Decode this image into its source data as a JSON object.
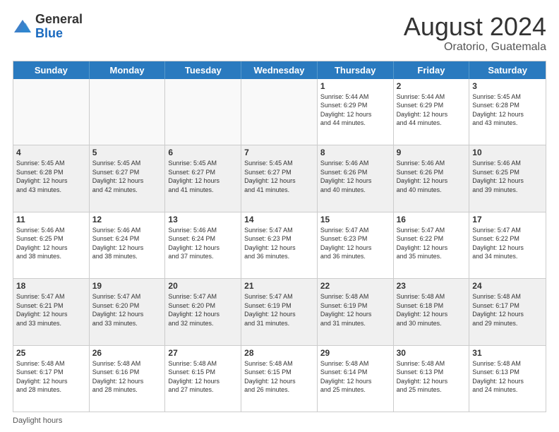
{
  "header": {
    "logo_general": "General",
    "logo_blue": "Blue",
    "month_title": "August 2024",
    "location": "Oratorio, Guatemala"
  },
  "weekdays": [
    "Sunday",
    "Monday",
    "Tuesday",
    "Wednesday",
    "Thursday",
    "Friday",
    "Saturday"
  ],
  "footer": {
    "daylight_hours_label": "Daylight hours"
  },
  "weeks": [
    [
      {
        "day": "",
        "info": "",
        "empty": true
      },
      {
        "day": "",
        "info": "",
        "empty": true
      },
      {
        "day": "",
        "info": "",
        "empty": true
      },
      {
        "day": "",
        "info": "",
        "empty": true
      },
      {
        "day": "1",
        "info": "Sunrise: 5:44 AM\nSunset: 6:29 PM\nDaylight: 12 hours\nand 44 minutes."
      },
      {
        "day": "2",
        "info": "Sunrise: 5:44 AM\nSunset: 6:29 PM\nDaylight: 12 hours\nand 44 minutes."
      },
      {
        "day": "3",
        "info": "Sunrise: 5:45 AM\nSunset: 6:28 PM\nDaylight: 12 hours\nand 43 minutes."
      }
    ],
    [
      {
        "day": "4",
        "info": "Sunrise: 5:45 AM\nSunset: 6:28 PM\nDaylight: 12 hours\nand 43 minutes."
      },
      {
        "day": "5",
        "info": "Sunrise: 5:45 AM\nSunset: 6:27 PM\nDaylight: 12 hours\nand 42 minutes."
      },
      {
        "day": "6",
        "info": "Sunrise: 5:45 AM\nSunset: 6:27 PM\nDaylight: 12 hours\nand 41 minutes."
      },
      {
        "day": "7",
        "info": "Sunrise: 5:45 AM\nSunset: 6:27 PM\nDaylight: 12 hours\nand 41 minutes."
      },
      {
        "day": "8",
        "info": "Sunrise: 5:46 AM\nSunset: 6:26 PM\nDaylight: 12 hours\nand 40 minutes."
      },
      {
        "day": "9",
        "info": "Sunrise: 5:46 AM\nSunset: 6:26 PM\nDaylight: 12 hours\nand 40 minutes."
      },
      {
        "day": "10",
        "info": "Sunrise: 5:46 AM\nSunset: 6:25 PM\nDaylight: 12 hours\nand 39 minutes."
      }
    ],
    [
      {
        "day": "11",
        "info": "Sunrise: 5:46 AM\nSunset: 6:25 PM\nDaylight: 12 hours\nand 38 minutes."
      },
      {
        "day": "12",
        "info": "Sunrise: 5:46 AM\nSunset: 6:24 PM\nDaylight: 12 hours\nand 38 minutes."
      },
      {
        "day": "13",
        "info": "Sunrise: 5:46 AM\nSunset: 6:24 PM\nDaylight: 12 hours\nand 37 minutes."
      },
      {
        "day": "14",
        "info": "Sunrise: 5:47 AM\nSunset: 6:23 PM\nDaylight: 12 hours\nand 36 minutes."
      },
      {
        "day": "15",
        "info": "Sunrise: 5:47 AM\nSunset: 6:23 PM\nDaylight: 12 hours\nand 36 minutes."
      },
      {
        "day": "16",
        "info": "Sunrise: 5:47 AM\nSunset: 6:22 PM\nDaylight: 12 hours\nand 35 minutes."
      },
      {
        "day": "17",
        "info": "Sunrise: 5:47 AM\nSunset: 6:22 PM\nDaylight: 12 hours\nand 34 minutes."
      }
    ],
    [
      {
        "day": "18",
        "info": "Sunrise: 5:47 AM\nSunset: 6:21 PM\nDaylight: 12 hours\nand 33 minutes."
      },
      {
        "day": "19",
        "info": "Sunrise: 5:47 AM\nSunset: 6:20 PM\nDaylight: 12 hours\nand 33 minutes."
      },
      {
        "day": "20",
        "info": "Sunrise: 5:47 AM\nSunset: 6:20 PM\nDaylight: 12 hours\nand 32 minutes."
      },
      {
        "day": "21",
        "info": "Sunrise: 5:47 AM\nSunset: 6:19 PM\nDaylight: 12 hours\nand 31 minutes."
      },
      {
        "day": "22",
        "info": "Sunrise: 5:48 AM\nSunset: 6:19 PM\nDaylight: 12 hours\nand 31 minutes."
      },
      {
        "day": "23",
        "info": "Sunrise: 5:48 AM\nSunset: 6:18 PM\nDaylight: 12 hours\nand 30 minutes."
      },
      {
        "day": "24",
        "info": "Sunrise: 5:48 AM\nSunset: 6:17 PM\nDaylight: 12 hours\nand 29 minutes."
      }
    ],
    [
      {
        "day": "25",
        "info": "Sunrise: 5:48 AM\nSunset: 6:17 PM\nDaylight: 12 hours\nand 28 minutes."
      },
      {
        "day": "26",
        "info": "Sunrise: 5:48 AM\nSunset: 6:16 PM\nDaylight: 12 hours\nand 28 minutes."
      },
      {
        "day": "27",
        "info": "Sunrise: 5:48 AM\nSunset: 6:15 PM\nDaylight: 12 hours\nand 27 minutes."
      },
      {
        "day": "28",
        "info": "Sunrise: 5:48 AM\nSunset: 6:15 PM\nDaylight: 12 hours\nand 26 minutes."
      },
      {
        "day": "29",
        "info": "Sunrise: 5:48 AM\nSunset: 6:14 PM\nDaylight: 12 hours\nand 25 minutes."
      },
      {
        "day": "30",
        "info": "Sunrise: 5:48 AM\nSunset: 6:13 PM\nDaylight: 12 hours\nand 25 minutes."
      },
      {
        "day": "31",
        "info": "Sunrise: 5:48 AM\nSunset: 6:13 PM\nDaylight: 12 hours\nand 24 minutes."
      }
    ]
  ]
}
